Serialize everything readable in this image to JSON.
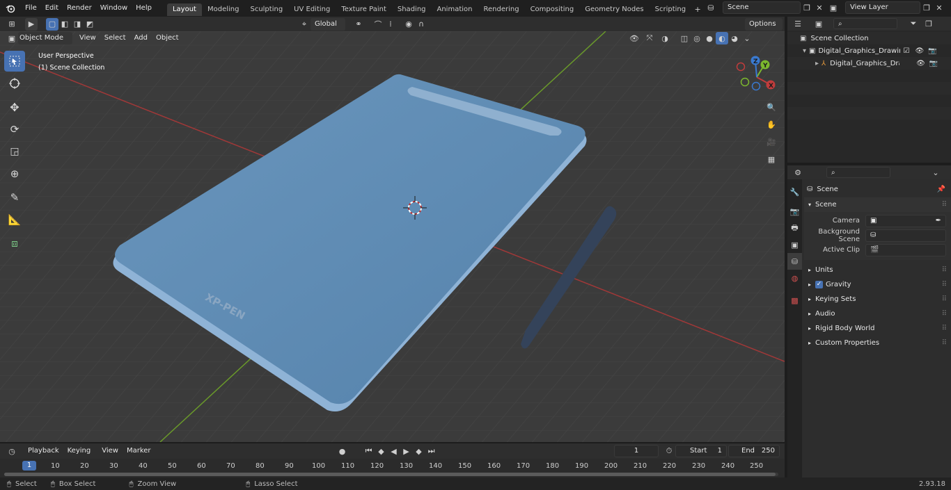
{
  "menus": [
    "File",
    "Edit",
    "Render",
    "Window",
    "Help"
  ],
  "workspaces": [
    "Layout",
    "Modeling",
    "Sculpting",
    "UV Editing",
    "Texture Paint",
    "Shading",
    "Animation",
    "Rendering",
    "Compositing",
    "Geometry Nodes",
    "Scripting"
  ],
  "topright": {
    "scene": "Scene",
    "view_layer": "View Layer"
  },
  "viewport": {
    "mode": "Object Mode",
    "menu": [
      "View",
      "Select",
      "Add",
      "Object"
    ],
    "transform_orientation": "Global",
    "options": "Options",
    "overlay_title": "User Perspective",
    "overlay_subtitle": "(1) Scene Collection",
    "logo_text": "XP-PEN",
    "gizmo": {
      "x": "X",
      "y": "Y",
      "z": "Z"
    }
  },
  "outliner": {
    "root": "Scene Collection",
    "items": [
      {
        "label": "Digital_Graphics_Drawing_Tab"
      },
      {
        "label": "Digital_Graphics_Drawing"
      }
    ]
  },
  "properties": {
    "context": "Scene",
    "panel": "Scene",
    "fields": [
      {
        "label": "Camera",
        "value": ""
      },
      {
        "label": "Background Scene",
        "value": ""
      },
      {
        "label": "Active Clip",
        "value": ""
      }
    ],
    "subpanels": [
      "Units",
      "Gravity",
      "Keying Sets",
      "Audio",
      "Rigid Body World",
      "Custom Properties"
    ]
  },
  "timeline": {
    "menus": [
      "Playback",
      "Keying",
      "View",
      "Marker"
    ],
    "current_frame": "1",
    "start_label": "Start",
    "start": "1",
    "end_label": "End",
    "end": "250",
    "ticks": [
      "1",
      "10",
      "20",
      "30",
      "40",
      "50",
      "60",
      "70",
      "80",
      "90",
      "100",
      "110",
      "120",
      "130",
      "140",
      "150",
      "160",
      "170",
      "180",
      "190",
      "200",
      "210",
      "220",
      "230",
      "240",
      "250"
    ]
  },
  "statusbar": {
    "select": "Select",
    "box_select": "Box Select",
    "zoom_view": "Zoom View",
    "lasso_select": "Lasso Select",
    "version": "2.93.18"
  },
  "colors": {
    "accent": "#4772b3",
    "tablet": "#5a88b0",
    "grid_red": "#b03a3a",
    "grid_green": "#6a9a2a"
  }
}
